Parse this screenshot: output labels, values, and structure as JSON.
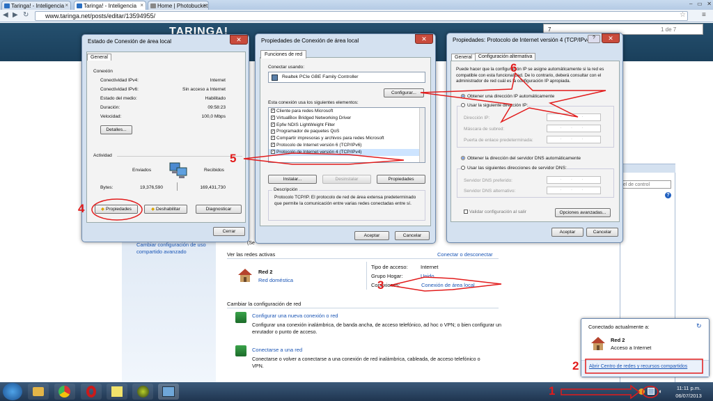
{
  "browser": {
    "tabs": [
      "Taringa! - Inteligencia",
      "Taringa! - Inteligencia",
      "Home | Photobucket"
    ],
    "url": "www.taringa.net/posts/editar/13594955/",
    "find_query": "7",
    "find_count": "1 de 7",
    "site_logo": "TARINGA!"
  },
  "win_status": {
    "title": "Estado de Conexión de área local",
    "tab": "General",
    "section_connection": "Conexión",
    "rows": [
      {
        "label": "Conectividad IPv4:",
        "value": "Internet"
      },
      {
        "label": "Conectividad IPv6:",
        "value": "Sin acceso a Internet"
      },
      {
        "label": "Estado del medio:",
        "value": "Habilitado"
      },
      {
        "label": "Duración:",
        "value": "09:58:23"
      },
      {
        "label": "Velocidad:",
        "value": "100,0 Mbps"
      }
    ],
    "details_btn": "Detalles...",
    "section_activity": "Actividad",
    "sent_label": "Enviados",
    "received_label": "Recibidos",
    "bytes_label": "Bytes:",
    "bytes_sent": "19,376,590",
    "bytes_received": "169,431,730",
    "properties_btn": "Propiedades",
    "disable_btn": "Deshabilitar",
    "diagnose_btn": "Diagnosticar",
    "close_btn": "Cerrar"
  },
  "win_props": {
    "title": "Propiedades de Conexión de área local",
    "tab": "Funciones de red",
    "connect_using_label": "Conectar usando:",
    "adapter": "Realtek PCIe GBE Family Controller",
    "configure_btn": "Configurar...",
    "items_label": "Esta conexión usa los siguientes elementos:",
    "items": [
      "Cliente para redes Microsoft",
      "VirtualBox Bridged Networking Driver",
      "Epfw NDIS LightWeight Filter",
      "Programador de paquetes QoS",
      "Compartir impresoras y archivos para redes Microsoft",
      "Protocolo de Internet versión 6 (TCP/IPv6)",
      "Protocolo de Internet versión 4 (TCP/IPv4)"
    ],
    "install_btn": "Instalar...",
    "uninstall_btn": "Desinstalar",
    "properties_btn": "Propiedades",
    "description_label": "Descripción",
    "description": "Protocolo TCP/IP. El protocolo de red de área extensa predeterminado que permite la comunicación entre varias redes conectadas entre sí.",
    "accept_btn": "Aceptar",
    "cancel_btn": "Cancelar"
  },
  "win_ipv4": {
    "title": "Propiedades: Protocolo de Internet versión 4 (TCP/IPv4)",
    "tab_general": "General",
    "tab_alt": "Configuración alternativa",
    "intro": "Puede hacer que la configuración IP se asigne automáticamente si la red es compatible con esta funcionalidad. De lo contrario, deberá consultar con el administrador de red cuál es la configuración IP apropiada.",
    "auto_ip": "Obtener una dirección IP automáticamente",
    "manual_ip": "Usar la siguiente dirección IP:",
    "ip_label": "Dirección IP:",
    "mask_label": "Máscara de subred:",
    "gateway_label": "Puerta de enlace predeterminada:",
    "auto_dns": "Obtener la dirección del servidor DNS automáticamente",
    "manual_dns": "Usar las siguientes direcciones de servidor DNS:",
    "dns_pref_label": "Servidor DNS preferido:",
    "dns_alt_label": "Servidor DNS alternativo:",
    "ip_placeholder": ". . .",
    "validate_label": "Validar configuración al salir",
    "advanced_btn": "Opciones avanzadas...",
    "accept_btn": "Aceptar",
    "cancel_btn": "Cancelar"
  },
  "control_panel": {
    "search_text": "nel de control",
    "side_link": "Cambiar configuración de uso compartido avanzado",
    "side_partial": "(Se",
    "active_networks": "Ver las redes activas",
    "connect_disconnect": "Conectar o desconectar",
    "network_name": "Red 2",
    "network_type": "Red doméstica",
    "access_type_label": "Tipo de acceso:",
    "access_type": "Internet",
    "homegroup_label": "Grupo Hogar:",
    "homegroup": "Unido",
    "connections_label": "Conexiones:",
    "connection_link": "Conexión de área local",
    "change_config": "Cambiar la configuración de red",
    "tasks": [
      {
        "title": "Configurar una nueva conexión o red",
        "desc": "Configurar una conexión inalámbrica, de banda ancha, de acceso telefónico, ad hoc o VPN; o bien configurar un enrutador o punto de acceso."
      },
      {
        "title": "Conectarse a una red",
        "desc": "Conectarse o volver a conectarse a una conexión de red inalámbrica, cableada, de acceso telefónico o VPN."
      }
    ]
  },
  "flyout": {
    "heading": "Conectado actualmente a:",
    "network_name": "Red 2",
    "network_status": "Acceso a Internet",
    "open_center_link": "Abrir Centro de redes y recursos compartidos"
  },
  "taskbar": {
    "time": "11:11 p.m.",
    "date": "06/07/2013"
  },
  "annotations": [
    "1",
    "2",
    "3",
    "4",
    "5",
    "6"
  ],
  "colors": {
    "annotation": "#e21b1b",
    "link": "#1a55b5",
    "taskbar": "#1f3550"
  }
}
